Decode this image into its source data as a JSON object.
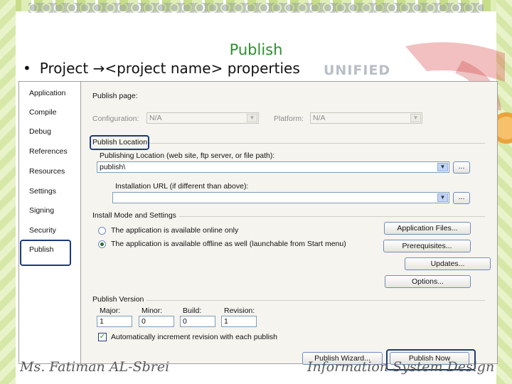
{
  "slide": {
    "title": "Publish",
    "bullet": "•",
    "bullet_text": "Project →<project name> properties",
    "brand_watermark": "UNIFIED",
    "footer_left": "Ms. Fatiman AL-Sbrei",
    "footer_right": "Information System Design"
  },
  "sidebar": {
    "items": [
      {
        "label": "Application"
      },
      {
        "label": "Compile"
      },
      {
        "label": "Debug"
      },
      {
        "label": "References"
      },
      {
        "label": "Resources"
      },
      {
        "label": "Settings"
      },
      {
        "label": "Signing"
      },
      {
        "label": "Security"
      },
      {
        "label": "Publish"
      }
    ],
    "selected": "Publish"
  },
  "publish_page": {
    "heading": "Publish page:",
    "configuration_label": "Configuration:",
    "configuration_value": "N/A",
    "platform_label": "Platform:",
    "platform_value": "N/A",
    "publish_location_label": "Publish Location",
    "publishing_location_label": "Publishing Location (web site, ftp server, or file path):",
    "publishing_location_value": "publish\\",
    "installation_url_label": "Installation URL (if different than above):",
    "installation_url_value": "",
    "browse_label": "...",
    "install_mode_label": "Install Mode and Settings",
    "radio_online_label": "The application is available online only",
    "radio_offline_label": "The application is available offline as well (launchable from Start menu)",
    "offline_selected": true,
    "buttons": {
      "application_files": "Application Files...",
      "prerequisites": "Prerequisites...",
      "updates": "Updates...",
      "options": "Options..."
    },
    "publish_version_label": "Publish Version",
    "major_label": "Major:",
    "minor_label": "Minor:",
    "build_label": "Build:",
    "revision_label": "Revision:",
    "major_value": "1",
    "minor_value": "0",
    "build_value": "0",
    "revision_value": "1",
    "auto_increment_label": "Automatically increment revision with each publish",
    "auto_increment_checked": true,
    "publish_wizard_label": "Publish Wizard...",
    "publish_now_label": "Publish Now",
    "check_mark": "✓",
    "dropdown_arrow": "▼"
  }
}
